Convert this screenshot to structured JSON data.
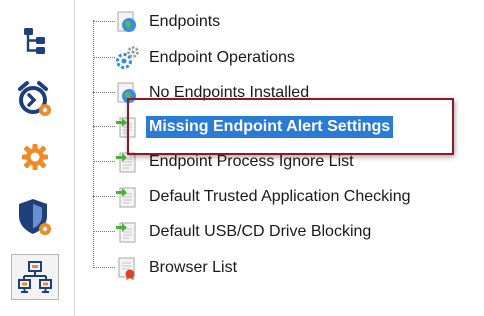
{
  "toolbar": {
    "buttons": [
      {
        "icon": "hierarchy-tree-icon",
        "active": false
      },
      {
        "icon": "alarm-clock-settings-icon",
        "active": false
      },
      {
        "icon": "settings-gear-icon",
        "active": false
      },
      {
        "icon": "security-shield-settings-icon",
        "active": false
      },
      {
        "icon": "network-computers-icon",
        "active": true
      }
    ]
  },
  "tree": {
    "items": [
      {
        "label": "Endpoints",
        "icon": "globe-document-icon"
      },
      {
        "label": "Endpoint Operations",
        "icon": "gears-icon"
      },
      {
        "label": "No Endpoints Installed",
        "icon": "globe-document-icon"
      },
      {
        "label": "Missing Endpoint Alert Settings",
        "icon": "document-arrow-icon",
        "selected": true
      },
      {
        "label": "Endpoint Process Ignore List",
        "icon": "document-arrow-icon"
      },
      {
        "label": "Default Trusted Application Checking",
        "icon": "document-arrow-icon"
      },
      {
        "label": "Default USB/CD Drive Blocking",
        "icon": "document-arrow-icon"
      },
      {
        "label": "Browser List",
        "icon": "document-badge-icon"
      }
    ]
  },
  "colors": {
    "selection": "#2a7bd6",
    "highlight_border": "#8b1a2b",
    "accent_orange": "#f08a24",
    "navy": "#1f3f7a"
  }
}
